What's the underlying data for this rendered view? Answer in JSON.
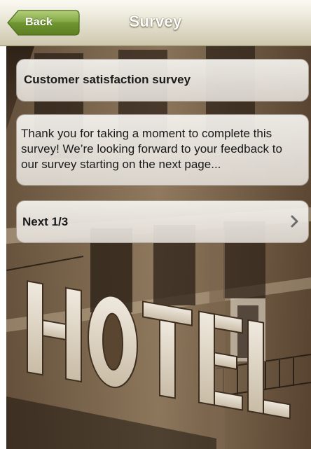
{
  "header": {
    "back_label": "Back",
    "title": "Survey"
  },
  "survey": {
    "name": "Customer satisfaction survey",
    "intro": "Thank you for taking a moment to complete this survey! We’re looking forward to your feedback to our survey starting on the next page...",
    "next_label": "Next 1/3"
  },
  "background": {
    "sign_text": "HOTEL"
  },
  "colors": {
    "back_button": "#7da23a",
    "header_top": "#fbfaf2",
    "header_bottom": "#cdc7ad",
    "photo_tone": "#4a3826"
  },
  "icons": {
    "next_card": "chevron-right-icon"
  }
}
